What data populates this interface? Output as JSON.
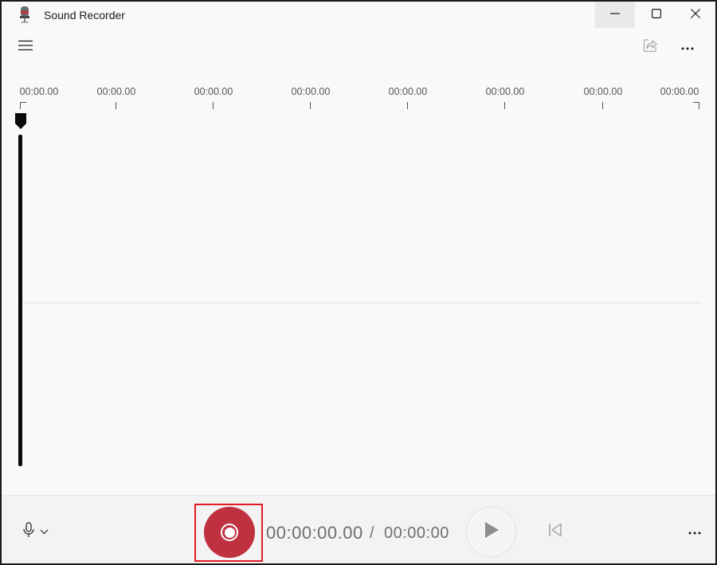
{
  "window": {
    "title": "Sound Recorder",
    "controls": {
      "minimize": "minimize-icon",
      "maximize": "maximize-icon",
      "close": "close-icon"
    }
  },
  "toolbar": {
    "menu_icon": "hamburger-menu-icon",
    "share_icon": "share-icon",
    "more_icon": "more-options-icon"
  },
  "timeline": {
    "tick_labels": [
      "00:00.00",
      "00:00.00",
      "00:00.00",
      "00:00.00",
      "00:00.00",
      "00:00.00",
      "00:00.00",
      "00:00.00"
    ]
  },
  "controls": {
    "microphone_icon": "microphone-icon",
    "record_icon": "record-icon",
    "record_color": "#c0313f",
    "current_time": "00:00:00.00",
    "separator": "/",
    "total_time": "00:00:00",
    "play_icon": "play-icon",
    "skip_back_icon": "skip-to-start-icon",
    "more_icon": "more-options-icon"
  }
}
